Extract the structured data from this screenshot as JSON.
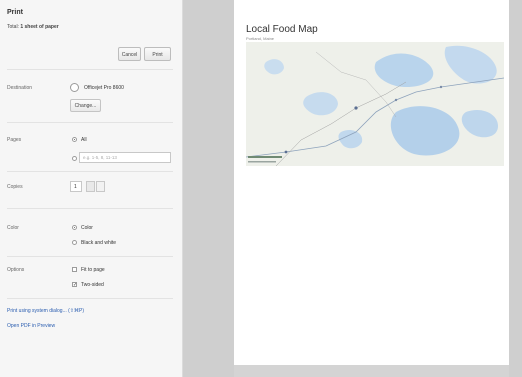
{
  "dialog": {
    "title": "Print",
    "total_prefix": "Total: ",
    "total_value": "1 sheet of paper",
    "cancel_label": "Cancel",
    "print_label": "Print"
  },
  "destination": {
    "label": "Destination",
    "printer": "Officejet Pro 8600",
    "change_label": "Change..."
  },
  "pages": {
    "label": "Pages",
    "all_label": "All",
    "range_placeholder": "e.g. 1-5, 8, 11-13"
  },
  "copies": {
    "label": "Copies",
    "value": "1"
  },
  "color": {
    "label": "Color",
    "option_color": "Color",
    "option_bw": "Black and white"
  },
  "options": {
    "label": "Options",
    "fit_to_page": "Fit to page",
    "two_sided": "Two-sided"
  },
  "links": {
    "system_dialog": "Print using system dialog... (⇧⌘P)",
    "open_pdf": "Open PDF in Preview"
  },
  "preview": {
    "title": "Local Food Map",
    "subtitle": "Portland, Maine"
  },
  "colors": {
    "sidebar_bg": "#f6f6f6",
    "gutter": "#cfcfcf",
    "link": "#2a5db0",
    "water": "#b9d4ec",
    "land": "#eef0ea"
  }
}
